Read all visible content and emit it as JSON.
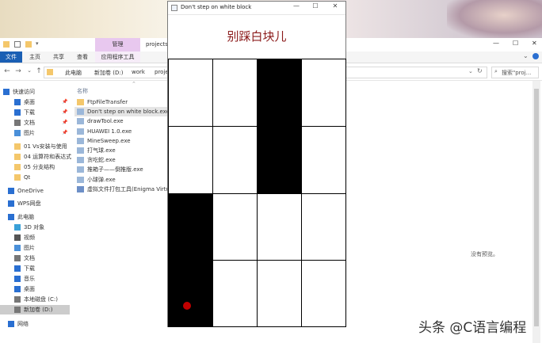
{
  "explorer": {
    "ribbon_context_tab": "管理",
    "title_path": "projects",
    "ribbon_tabs": [
      "文件",
      "主页",
      "共享",
      "查看",
      "应用程序工具"
    ],
    "address_segments": [
      "此电脑",
      "新加卷 (D:)",
      "work",
      "proje"
    ],
    "search_placeholder": "搜索\"proj...",
    "column_header": "名称",
    "sidebar_items": [
      {
        "label": "快速访问",
        "icon": "star-icon",
        "pinned": false
      },
      {
        "label": "桌面",
        "icon": "desktop-icon",
        "pinned": true
      },
      {
        "label": "下载",
        "icon": "download-icon",
        "pinned": true
      },
      {
        "label": "文档",
        "icon": "document-icon",
        "pinned": true
      },
      {
        "label": "图片",
        "icon": "picture-icon",
        "pinned": true
      },
      {
        "label": "01 Vs安装与使用",
        "icon": "folder-icon",
        "pinned": false
      },
      {
        "label": "04 运算符和表达式",
        "icon": "folder-icon",
        "pinned": false
      },
      {
        "label": "05 分支结构",
        "icon": "folder-icon",
        "pinned": false
      },
      {
        "label": "Qt",
        "icon": "folder-icon",
        "pinned": false
      },
      {
        "label": "OneDrive",
        "icon": "cloud-icon",
        "pinned": false
      },
      {
        "label": "WPS网盘",
        "icon": "cloud-icon",
        "pinned": false
      },
      {
        "label": "此电脑",
        "icon": "computer-icon",
        "pinned": false
      },
      {
        "label": "3D 对象",
        "icon": "cube-icon",
        "pinned": false
      },
      {
        "label": "视频",
        "icon": "video-icon",
        "pinned": false
      },
      {
        "label": "图片",
        "icon": "picture-icon",
        "pinned": false
      },
      {
        "label": "文档",
        "icon": "document-icon",
        "pinned": false
      },
      {
        "label": "下载",
        "icon": "download-icon",
        "pinned": false
      },
      {
        "label": "音乐",
        "icon": "music-icon",
        "pinned": false
      },
      {
        "label": "桌面",
        "icon": "desktop-icon",
        "pinned": false
      },
      {
        "label": "本地磁盘 (C:)",
        "icon": "drive-icon",
        "pinned": false
      },
      {
        "label": "新加卷 (D:)",
        "icon": "drive-icon",
        "pinned": false
      },
      {
        "label": "网络",
        "icon": "network-icon",
        "pinned": false
      }
    ],
    "files": [
      {
        "name": "FtpFileTransfer",
        "icon": "folder-icon"
      },
      {
        "name": "Don't step on white block.exe",
        "icon": "exe-icon"
      },
      {
        "name": "drawTool.exe",
        "icon": "exe-icon"
      },
      {
        "name": "HUAWEI 1.0.exe",
        "icon": "exe-icon"
      },
      {
        "name": "MineSweep.exe",
        "icon": "exe-icon"
      },
      {
        "name": "打气球.exe",
        "icon": "exe-icon"
      },
      {
        "name": "贪吃蛇.exe",
        "icon": "exe-icon"
      },
      {
        "name": "推箱子——倒推版.exe",
        "icon": "exe-icon"
      },
      {
        "name": "小球弹.exe",
        "icon": "exe-icon"
      },
      {
        "name": "虚拟文件打包工具(Enigma Virtual",
        "icon": "package-icon"
      }
    ],
    "preview_text": "没有预览。"
  },
  "game": {
    "window_title": "Don't step on white block",
    "heading": "别踩白块儿",
    "board": [
      [
        0,
        0,
        1,
        0
      ],
      [
        0,
        0,
        1,
        0
      ],
      [
        1,
        0,
        0,
        0
      ],
      [
        1,
        0,
        0,
        0
      ]
    ],
    "dot_color": "#c00000"
  },
  "watermark": "头条 @C语言编程"
}
